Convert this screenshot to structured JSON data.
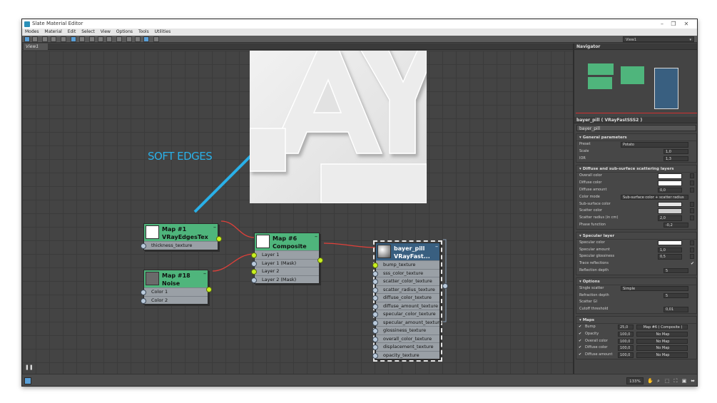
{
  "window": {
    "title": "Slate Material Editor"
  },
  "menu": [
    "Modes",
    "Material",
    "Edit",
    "Select",
    "View",
    "Options",
    "Tools",
    "Utilities"
  ],
  "toolbar": {
    "view_select": "View1"
  },
  "tabs": {
    "view": "View1"
  },
  "annotation": {
    "text": "SOFT EDGES",
    "color": "#2ab0e8"
  },
  "preview": {
    "letters": "AY"
  },
  "nodes": {
    "edges": {
      "title": "Map #1",
      "subtitle": "VRayEdgesTex",
      "slots": [
        "thickness_texture"
      ]
    },
    "noise": {
      "title": "Map #18",
      "subtitle": "Noise",
      "slots": [
        "Color 1",
        "Color 2"
      ]
    },
    "composite": {
      "title": "Map #6",
      "subtitle": "Composite",
      "slots": [
        "Layer 1",
        "Layer 1 (Mask)",
        "Layer 2",
        "Layer 2 (Mask)"
      ]
    },
    "material": {
      "title": "bayer_pill",
      "subtitle": "VRayFast...",
      "slots": [
        "bump_texture",
        "sss_color_texture",
        "scatter_color_texture",
        "scatter_radius_texture",
        "diffuse_color_texture",
        "diffuse_amount_texture",
        "specular_color_texture",
        "specular_amount_texture",
        "glossiness_texture",
        "overall_color_texture",
        "displacement_texture",
        "opacity_texture"
      ]
    }
  },
  "navigator": {
    "title": "Navigator"
  },
  "properties": {
    "title": "bayer_pill  ( VRayFastSSS2 )",
    "name": "bayer_pill",
    "general": {
      "title": "General parameters",
      "preset_label": "Preset",
      "preset_value": "Potato",
      "scale_label": "Scale",
      "scale_value": "1,0",
      "ior_label": "IOR",
      "ior_value": "1,3"
    },
    "diffuse": {
      "title": "Diffuse and sub-surface scattering layers",
      "overall_color": "Overall color",
      "diffuse_color": "Diffuse color",
      "diffuse_amount": "Diffuse amount",
      "diffuse_amount_value": "0,0",
      "color_mode": "Color mode",
      "color_mode_value": "Sub-surface color + scatter radius",
      "subsurface_color": "Sub-surface color",
      "scatter_color": "Scatter color",
      "scatter_radius": "Scatter radius (in cm)",
      "scatter_radius_value": "2,0",
      "phase_function": "Phase function",
      "phase_function_value": "-0,2"
    },
    "specular": {
      "title": "Specular layer",
      "specular_color": "Specular color",
      "specular_amount": "Specular amount",
      "specular_amount_value": "1,0",
      "specular_glossiness": "Specular glossiness",
      "specular_glossiness_value": "0,5",
      "trace_reflections": "Trace reflections",
      "reflection_depth": "Reflection depth",
      "reflection_depth_value": "5"
    },
    "options": {
      "title": "Options",
      "single_scatter": "Single scatter",
      "single_scatter_value": "Simple",
      "refraction_depth": "Refraction depth",
      "refraction_depth_value": "5",
      "scatter_gi": "Scatter GI",
      "cutoff": "Cutoff threshold",
      "cutoff_value": "0,01"
    },
    "maps": {
      "title": "Maps",
      "rows": [
        {
          "label": "Bump",
          "value": "25,0",
          "map": "Map #6  ( Composite )"
        },
        {
          "label": "Opacity",
          "value": "100,0",
          "map": "No Map"
        },
        {
          "label": "Overall color",
          "value": "100,0",
          "map": "No Map"
        },
        {
          "label": "Diffuse color",
          "value": "100,0",
          "map": "No Map"
        },
        {
          "label": "Diffuse amount",
          "value": "100,0",
          "map": "No Map"
        }
      ]
    }
  },
  "status": {
    "zoom": "133%"
  },
  "colors": {
    "node_green": "#4fb57c",
    "node_blue": "#395f80",
    "wire": "#e0403a",
    "pin_live": "#c8f020"
  }
}
